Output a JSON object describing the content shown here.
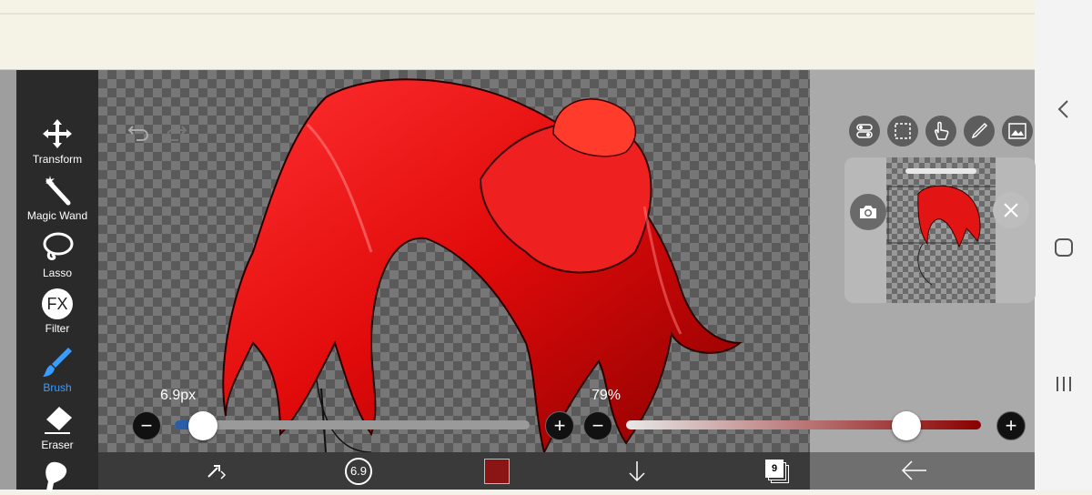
{
  "tools": [
    {
      "label": "Transform",
      "icon": "move-arrows-icon"
    },
    {
      "label": "Magic Wand",
      "icon": "magic-wand-icon"
    },
    {
      "label": "Lasso",
      "icon": "lasso-icon"
    },
    {
      "label": "Filter",
      "icon": "fx-icon"
    },
    {
      "label": "Brush",
      "icon": "brush-icon",
      "active": true
    },
    {
      "label": "Eraser",
      "icon": "eraser-icon"
    }
  ],
  "fx_text": "FX",
  "brush": {
    "size_label": "6.9px",
    "size_fraction": 0.08
  },
  "opacity": {
    "label": "79%",
    "value": 0.79
  },
  "bottom": {
    "brush_size_badge": "6.9",
    "layer_count": "9",
    "color": "#8b1515"
  },
  "colors": {
    "accent": "#3b9cff",
    "hair": "#e01010"
  },
  "right_icons": [
    "toggle-icon",
    "selection-icon",
    "touch-icon",
    "eyedropper-icon",
    "image-icon"
  ]
}
